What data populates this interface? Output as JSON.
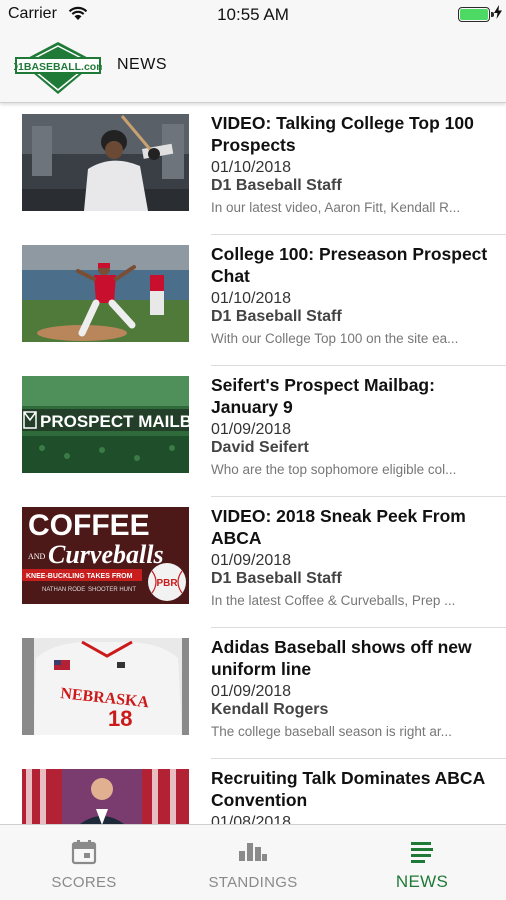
{
  "status_bar": {
    "carrier": "Carrier",
    "time": "10:55 AM"
  },
  "header": {
    "logo_text": "D1BASEBALL.com",
    "title": "NEWS"
  },
  "news": [
    {
      "title": "VIDEO: Talking College Top 100 Prospects",
      "date": "01/10/2018",
      "author": "D1 Baseball Staff",
      "snippet": "In our latest video, Aaron Fitt, Kendall R..."
    },
    {
      "title": "College 100: Preseason Prospect Chat",
      "date": "01/10/2018",
      "author": "D1 Baseball Staff",
      "snippet": "With our College Top 100 on the site ea..."
    },
    {
      "title": "Seifert's Prospect Mailbag: January 9",
      "date": "01/09/2018",
      "author": "David Seifert",
      "snippet": "Who are the top sophomore eligible col...",
      "image_text": "PROSPECT MAILBA"
    },
    {
      "title": "VIDEO: 2018 Sneak Peek From ABCA",
      "date": "01/09/2018",
      "author": "D1 Baseball Staff",
      "snippet": "In the latest Coffee & Curveballs, Prep ...",
      "image_text": {
        "coffee": "COFFEE",
        "and": "AND",
        "curveballs": "Curveballs",
        "tagline": "KNEE-BUCKLING TAKES FROM",
        "name1": "NATHAN RODE",
        "name2": "SHOOTER HUNT",
        "badge": "PBR"
      }
    },
    {
      "title": "Adidas Baseball shows off new uniform line",
      "date": "01/09/2018",
      "author": "Kendall Rogers",
      "snippet": "The college baseball season is right ar...",
      "image_text": {
        "jersey": "NEBRASKA",
        "number": "18"
      }
    },
    {
      "title": "Recruiting Talk Dominates ABCA Convention",
      "date": "01/08/2018",
      "author": "",
      "snippet": ""
    }
  ],
  "tabs": [
    {
      "label": "SCORES",
      "icon": "calendar-icon",
      "active": false
    },
    {
      "label": "STANDINGS",
      "icon": "bar-chart-icon",
      "active": false
    },
    {
      "label": "NEWS",
      "icon": "list-icon",
      "active": true
    }
  ],
  "colors": {
    "brand_green": "#1e7a36",
    "active_tab": "#1e7a36",
    "inactive_tab": "#8a8a8a",
    "battery": "#4cd964"
  }
}
